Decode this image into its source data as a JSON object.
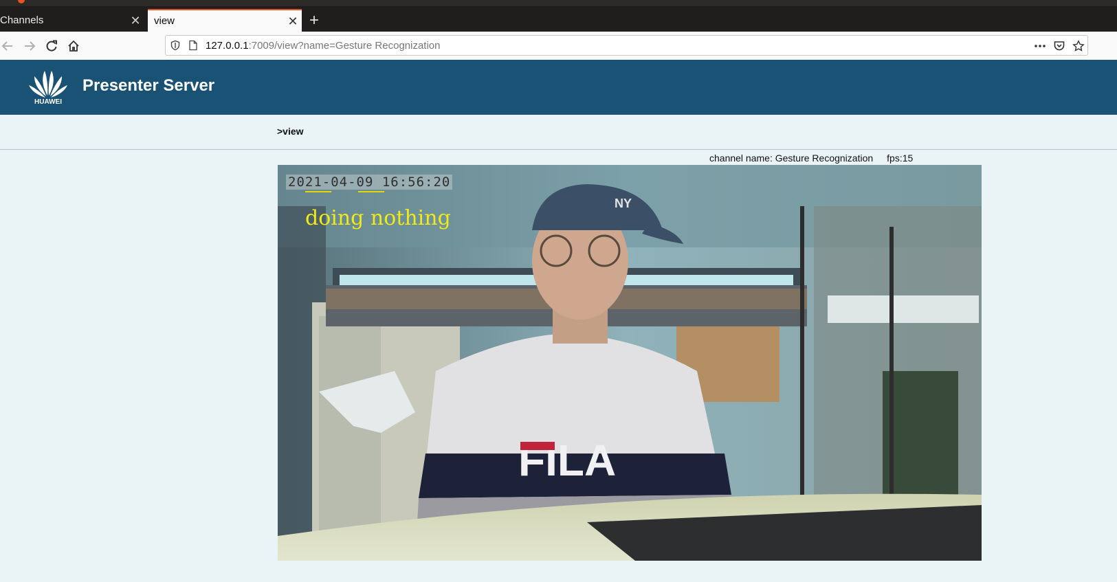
{
  "browser": {
    "tabs": [
      {
        "label": "Channels",
        "active": false
      },
      {
        "label": "view",
        "active": true
      }
    ],
    "url_host": "127.0.0.1",
    "url_rest": ":7009/view?name=Gesture Recognization",
    "icons": [
      "back-arrow-icon",
      "forward-arrow-icon",
      "reload-icon",
      "home-icon",
      "shield-icon",
      "page-icon",
      "more-icon",
      "pocket-icon",
      "star-icon"
    ]
  },
  "header": {
    "logo_text": "HUAWEI",
    "title": "Presenter Server",
    "bg_color": "#1a5275"
  },
  "breadcrumb": ">view",
  "channel": {
    "name_label": "channel name: Gesture Recognization",
    "fps_label": "fps:15"
  },
  "video": {
    "timestamp": "2021-04-09 16:56:20",
    "gesture_label": "doing nothing",
    "shirt_text": "FILA",
    "cap_text": "NY"
  },
  "colors": {
    "accent": "#e95420",
    "overlay_text": "#f0ea1a",
    "page_bg": "#eaf4f7"
  }
}
